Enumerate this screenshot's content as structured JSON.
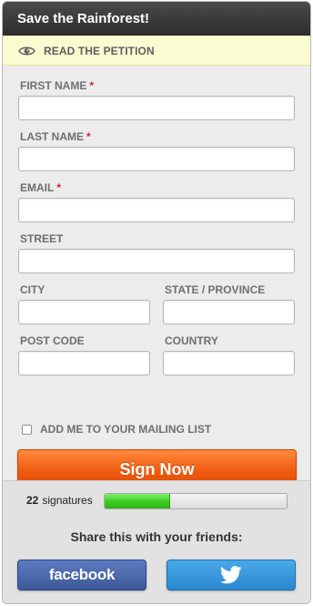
{
  "header": {
    "title": "Save the Rainforest!"
  },
  "petition": {
    "label": "READ THE PETITION",
    "icon": "eye-icon"
  },
  "form": {
    "first_name": {
      "label": "FIRST NAME",
      "required": "*",
      "value": "",
      "placeholder": ""
    },
    "last_name": {
      "label": "LAST NAME",
      "required": "*",
      "value": "",
      "placeholder": ""
    },
    "email": {
      "label": "EMAIL",
      "required": "*",
      "value": "",
      "placeholder": ""
    },
    "street": {
      "label": "STREET",
      "value": "",
      "placeholder": ""
    },
    "city": {
      "label": "CITY",
      "value": "",
      "placeholder": ""
    },
    "state": {
      "label": "STATE / PROVINCE",
      "value": "",
      "placeholder": ""
    },
    "post_code": {
      "label": "POST CODE",
      "value": "",
      "placeholder": ""
    },
    "country": {
      "label": "COUNTRY",
      "value": "",
      "placeholder": ""
    },
    "mailing_list": {
      "label": "ADD ME TO YOUR MAILING LIST",
      "checked": false
    },
    "submit_label": "Sign Now"
  },
  "signatures": {
    "count": "22",
    "label": "signatures",
    "progress_fraction": 0.36
  },
  "share": {
    "title": "Share this with your friends:",
    "facebook_label": "facebook",
    "twitter_icon": "twitter-bird-icon"
  },
  "colors": {
    "accent_orange": "#ee5a0f",
    "progress_green": "#3ccb21",
    "facebook_blue": "#3b5998",
    "twitter_blue": "#2a87cf",
    "required_red": "#d0242a"
  }
}
